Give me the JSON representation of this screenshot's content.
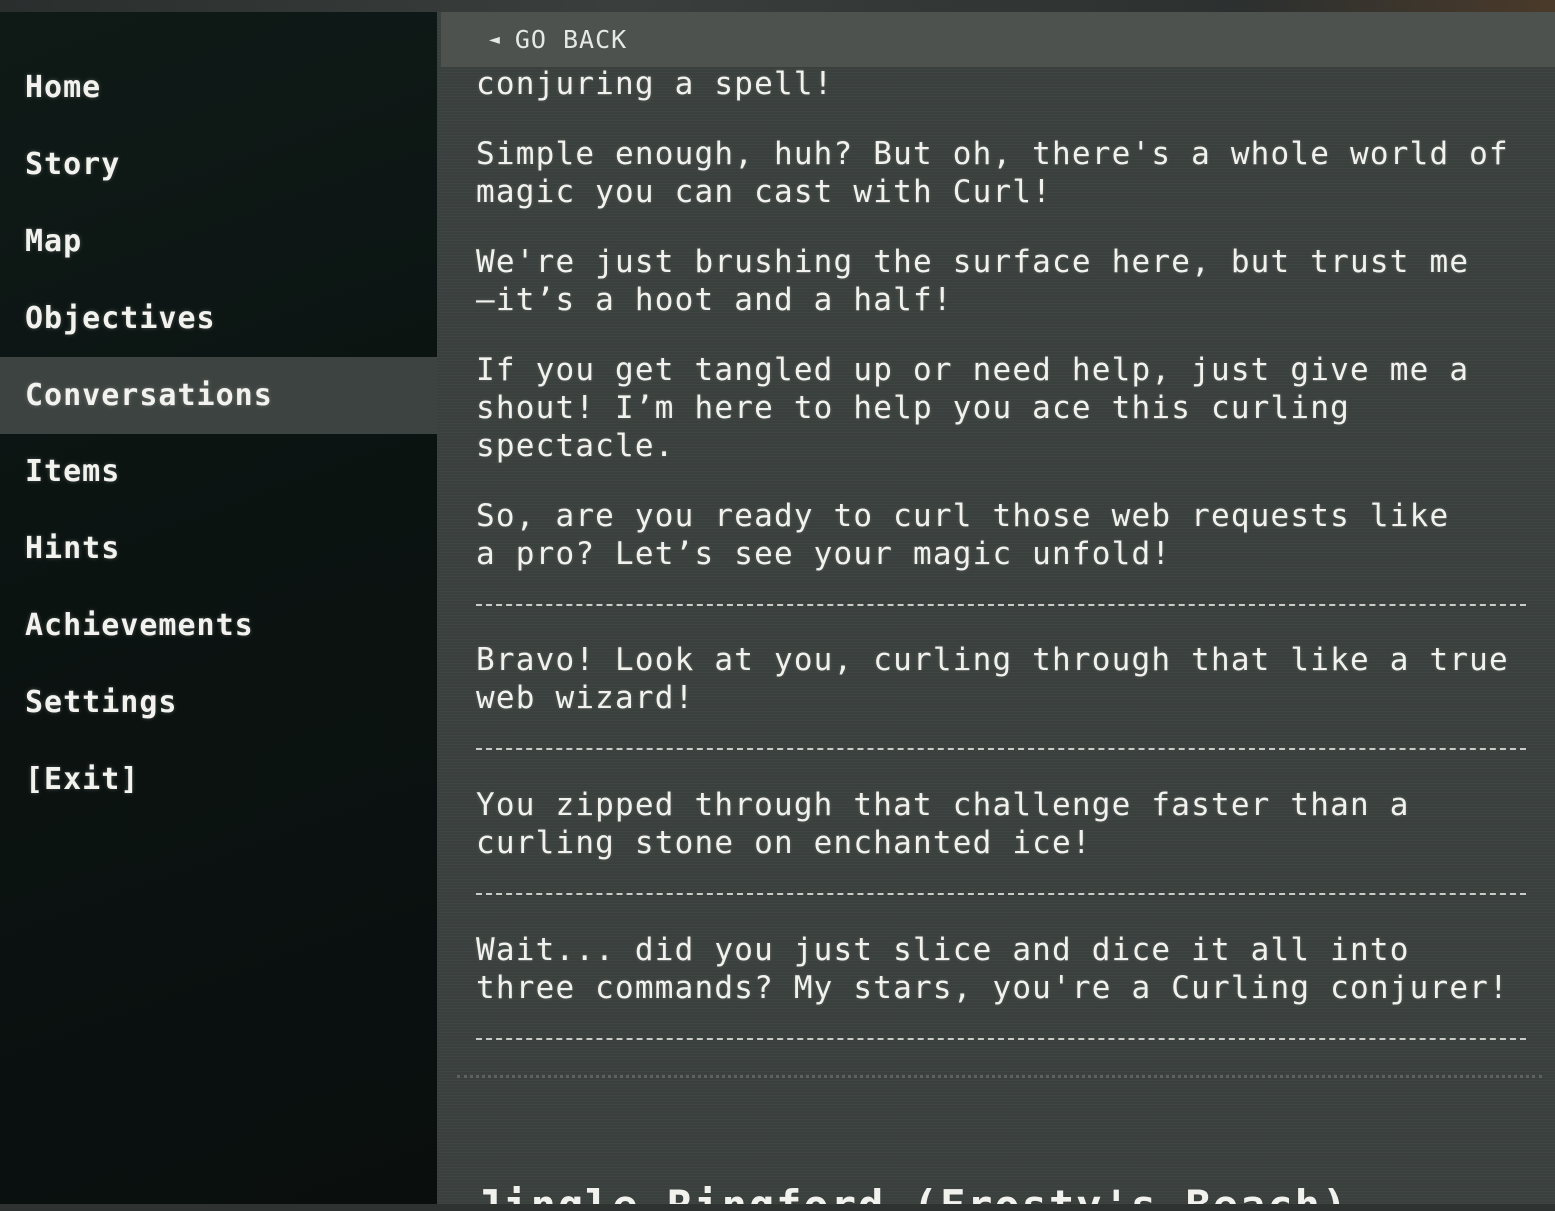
{
  "sidebar": {
    "items": [
      {
        "label": "Home"
      },
      {
        "label": "Story"
      },
      {
        "label": "Map"
      },
      {
        "label": "Objectives"
      },
      {
        "label": "Conversations",
        "active": true
      },
      {
        "label": "Items"
      },
      {
        "label": "Hints"
      },
      {
        "label": "Achievements"
      },
      {
        "label": "Settings"
      },
      {
        "label": "[Exit]"
      }
    ]
  },
  "main": {
    "go_back_icon": "◄",
    "go_back_label": "GO BACK",
    "messages": [
      "conjuring a spell!",
      "Simple enough, huh? But oh, there's a whole world of magic you can cast with Curl!",
      "We're just brushing the surface here, but trust me—it’s a hoot and a half!",
      "If you get tangled up or need help, just give me a shout! I’m here to help you ace this curling spectacle.",
      "So, are you ready to curl those web requests like a pro? Let’s see your magic unfold!",
      "Bravo! Look at you, curling through that like a true web wizard!",
      "You zipped through that challenge faster than a curling stone on enchanted ice!",
      "Wait... did you just slice and dice it all into three commands? My stars, you're a Curling conjurer!"
    ],
    "next_conversation_title": "Jingle Ringford (Frosty's Beach)"
  }
}
